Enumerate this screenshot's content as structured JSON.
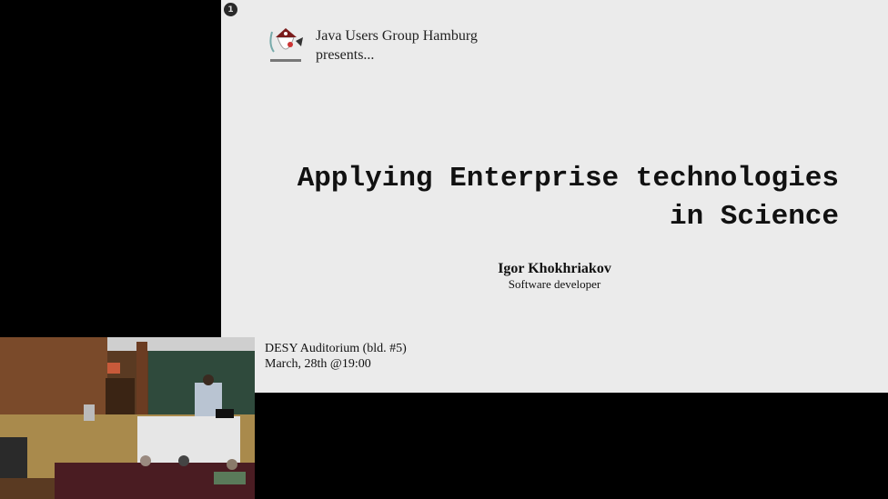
{
  "slide": {
    "page_number": "1",
    "organizer": "Java Users Group Hamburg",
    "presents": "presents...",
    "title_line1": "Applying Enterprise technologies",
    "title_line2": "in Science",
    "speaker_name": "Igor Khokhriakov",
    "speaker_role": "Software developer",
    "venue": "DESY Auditorium (bld. #5)",
    "date": "March, 28th @19:00"
  }
}
